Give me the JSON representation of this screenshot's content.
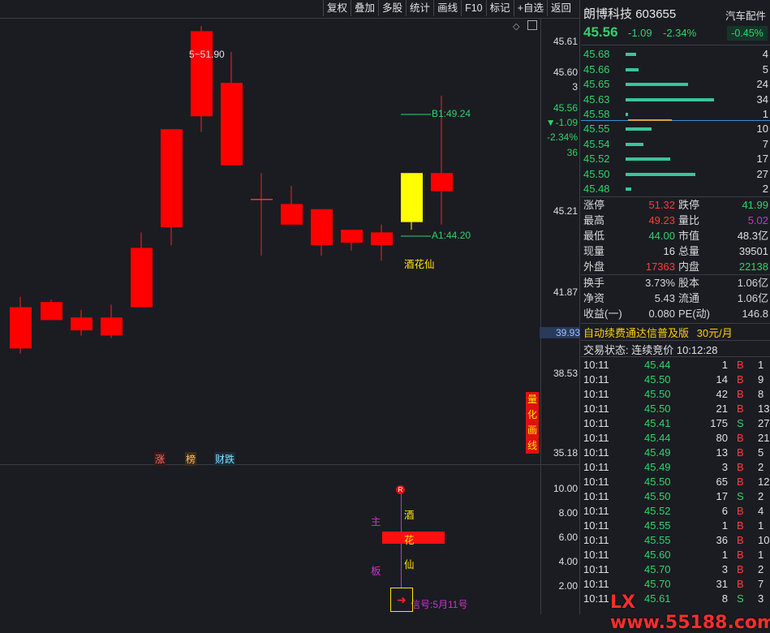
{
  "toolbar": [
    "复权",
    "叠加",
    "多股",
    "统计",
    "画线",
    "F10",
    "标记",
    "+自选",
    "返回"
  ],
  "chart": {
    "price_labels": [
      "45.61",
      "45.60",
      "3",
      "45.56",
      "▼-1.09",
      "-2.34%",
      "36",
      "45.21",
      "41.87",
      "39.93",
      "38.53",
      "35.18"
    ],
    "peak_label": "5~51.90",
    "b1_label": "B1:49.24",
    "a1_label": "A1:44.20",
    "wine_label": "酒花仙",
    "bottom_marks": [
      "涨",
      "榜",
      "财跌"
    ],
    "side_badge": [
      "量",
      "化",
      "画",
      "线"
    ]
  },
  "indicator": {
    "y_labels": [
      "10.00",
      "8.00",
      "6.00",
      "4.00",
      "2.00"
    ],
    "zhu": "主",
    "ban": "板",
    "chars": [
      "酒",
      "花",
      "仙"
    ],
    "signal": "信号:5月11号",
    "r_badge": "R"
  },
  "stock": {
    "name": "朗博科技",
    "code": "603655",
    "sector": "汽车配件",
    "price": "45.56",
    "change": "-1.09",
    "change_pct": "-2.34%",
    "sector_pct": "-0.45%"
  },
  "asks": [
    {
      "price": "45.68",
      "vol": "4",
      "bar": 0.12
    },
    {
      "price": "45.66",
      "vol": "5",
      "bar": 0.14
    },
    {
      "price": "45.65",
      "vol": "24",
      "bar": 0.69
    },
    {
      "price": "45.63",
      "vol": "34",
      "bar": 0.97
    },
    {
      "price": "45.58",
      "vol": "1",
      "bar": 0.03
    }
  ],
  "bids": [
    {
      "price": "45.55",
      "vol": "10",
      "bar": 0.29
    },
    {
      "price": "45.54",
      "vol": "7",
      "bar": 0.2
    },
    {
      "price": "45.52",
      "vol": "17",
      "bar": 0.49
    },
    {
      "price": "45.50",
      "vol": "27",
      "bar": 0.77
    },
    {
      "price": "45.48",
      "vol": "2",
      "bar": 0.06
    }
  ],
  "stats1": [
    {
      "k1": "涨停",
      "v1": "51.32",
      "c1": "red",
      "k2": "跌停",
      "v2": "41.99",
      "c2": "grn"
    },
    {
      "k1": "最高",
      "v1": "49.23",
      "c1": "red",
      "k2": "量比",
      "v2": "5.02",
      "c2": "mag"
    },
    {
      "k1": "最低",
      "v1": "44.00",
      "c1": "grn",
      "k2": "市值",
      "v2": "48.3亿",
      "c2": "wht"
    },
    {
      "k1": "现量",
      "v1": "16",
      "c1": "wht",
      "k2": "总量",
      "v2": "39501",
      "c2": "wht"
    },
    {
      "k1": "外盘",
      "v1": "17363",
      "c1": "red",
      "k2": "内盘",
      "v2": "22138",
      "c2": "grn"
    }
  ],
  "stats2": [
    {
      "k1": "换手",
      "v1": "3.73%",
      "k2": "股本",
      "v2": "1.06亿"
    },
    {
      "k1": "净资",
      "v1": "5.43",
      "k2": "流通",
      "v2": "1.06亿"
    },
    {
      "k1": "收益(一)",
      "v1": "0.080",
      "k2": "PE(动)",
      "v2": "146.8"
    }
  ],
  "promo": {
    "text": "自动续费通达信普及版",
    "price": "30元/月"
  },
  "trade_status": "交易状态: 连续竞价 10:12:28",
  "ticks": [
    {
      "t": "10:11",
      "p": "45.44",
      "v": "1",
      "d": "B",
      "n": "1"
    },
    {
      "t": "10:11",
      "p": "45.50",
      "v": "14",
      "d": "B",
      "n": "9"
    },
    {
      "t": "10:11",
      "p": "45.50",
      "v": "42",
      "d": "B",
      "n": "8"
    },
    {
      "t": "10:11",
      "p": "45.50",
      "v": "21",
      "d": "B",
      "n": "13"
    },
    {
      "t": "10:11",
      "p": "45.41",
      "v": "175",
      "d": "S",
      "n": "27"
    },
    {
      "t": "10:11",
      "p": "45.44",
      "v": "80",
      "d": "B",
      "n": "21"
    },
    {
      "t": "10:11",
      "p": "45.49",
      "v": "13",
      "d": "B",
      "n": "5"
    },
    {
      "t": "10:11",
      "p": "45.49",
      "v": "3",
      "d": "B",
      "n": "2"
    },
    {
      "t": "10:11",
      "p": "45.50",
      "v": "65",
      "d": "B",
      "n": "12"
    },
    {
      "t": "10:11",
      "p": "45.50",
      "v": "17",
      "d": "S",
      "n": "2"
    },
    {
      "t": "10:11",
      "p": "45.52",
      "v": "6",
      "d": "B",
      "n": "4"
    },
    {
      "t": "10:11",
      "p": "45.55",
      "v": "1",
      "d": "B",
      "n": "1"
    },
    {
      "t": "10:11",
      "p": "45.55",
      "v": "36",
      "d": "B",
      "n": "10"
    },
    {
      "t": "10:11",
      "p": "45.60",
      "v": "1",
      "d": "B",
      "n": "1"
    },
    {
      "t": "10:11",
      "p": "45.70",
      "v": "3",
      "d": "B",
      "n": "2"
    },
    {
      "t": "10:11",
      "p": "45.70",
      "v": "31",
      "d": "B",
      "n": "7"
    },
    {
      "t": "10:11",
      "p": "45.61",
      "v": "8",
      "d": "S",
      "n": "3"
    }
  ],
  "watermark": "LX www.55188.com"
}
